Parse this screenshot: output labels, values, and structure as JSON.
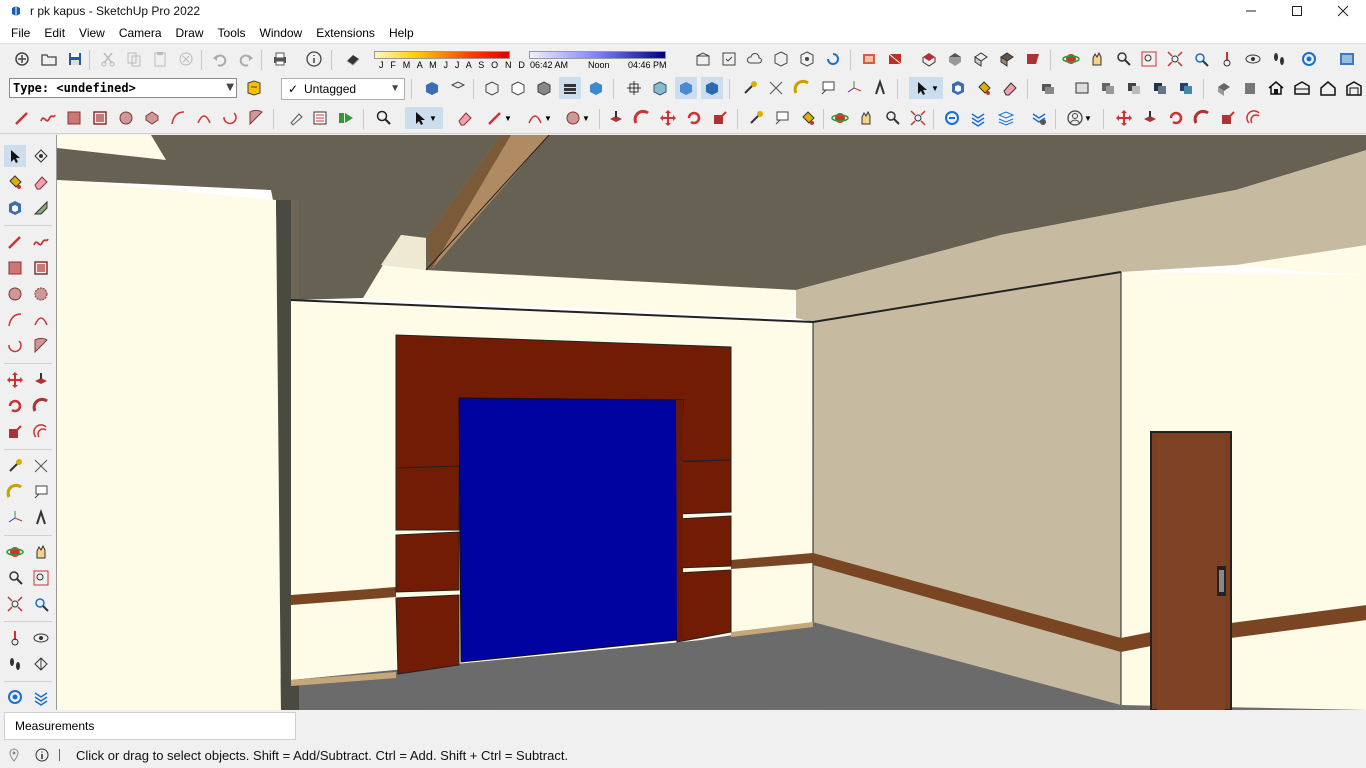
{
  "window": {
    "title": "r pk kapus - SketchUp Pro 2022",
    "controls": [
      "minimize",
      "maximize",
      "close"
    ]
  },
  "menu": [
    "File",
    "Edit",
    "View",
    "Camera",
    "Draw",
    "Tools",
    "Window",
    "Extensions",
    "Help"
  ],
  "toolbar": {
    "type_selector": "Type: <undefined>",
    "tag_selector": "Untagged",
    "shadow": {
      "months": "J F M A M J J A S O N D",
      "time_start": "06:42 AM",
      "time_mid": "Noon",
      "time_end": "04:46 PM"
    }
  },
  "measurements": {
    "label": "Measurements",
    "value": ""
  },
  "status": {
    "message": "Click or drag to select objects. Shift = Add/Subtract. Ctrl = Add. Shift + Ctrl = Subtract."
  },
  "colors": {
    "ceiling": "#676154",
    "wall_light": "#fefce6",
    "wall_tan": "#c6bba0",
    "floor": "#6e6e6e",
    "frame_brown": "#721c05",
    "door_blue": "#00039f",
    "door_wood": "#7b3f22",
    "rail_brown": "#7a4522"
  },
  "icons": [
    "select-icon",
    "orbit-icon",
    "paint-bucket-icon",
    "eraser-icon",
    "pencil-icon",
    "freehand-icon",
    "rectangle-icon",
    "rotated-rectangle-icon",
    "circle-icon",
    "polygon-icon",
    "arc-icon",
    "pie-icon",
    "move-icon",
    "push-pull-icon",
    "rotate-icon",
    "follow-me-icon",
    "scale-icon",
    "offset-icon",
    "tape-measure-icon",
    "dimension-icon",
    "protractor-icon",
    "text-icon",
    "axes-icon",
    "3d-text-icon",
    "pan-icon",
    "zoom-icon",
    "zoom-window-icon",
    "zoom-extents-icon",
    "walk-icon",
    "look-around-icon",
    "position-camera-icon",
    "section-plane-icon"
  ]
}
